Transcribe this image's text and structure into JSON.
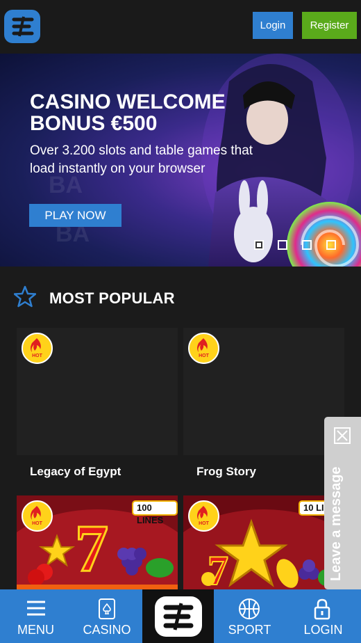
{
  "header": {
    "logo_icon": "brand-logo-icon",
    "login_label": "Login",
    "register_label": "Register"
  },
  "hero": {
    "title": "CASINO WELCOME BONUS €500",
    "subtitle": "Over 3.200 slots and table games that load instantly on your browser",
    "cta_label": "PLAY NOW",
    "slide_count": 4,
    "active_slide": 1
  },
  "section": {
    "icon": "star-icon",
    "title": "MOST POPULAR"
  },
  "games": [
    {
      "name": "Legacy of Egypt",
      "badge": "HOT"
    },
    {
      "name": "Frog Story",
      "badge": "HOT"
    },
    {
      "name": "",
      "badge": "HOT",
      "lines": "100 LINES"
    },
    {
      "name": "",
      "badge": "HOT",
      "lines": "10 LI"
    }
  ],
  "chat": {
    "label": "Leave a message"
  },
  "bottom_nav": {
    "items": [
      {
        "label": "MENU",
        "icon": "hamburger-icon"
      },
      {
        "label": "CASINO",
        "icon": "card-icon"
      },
      {
        "label": "SPORT",
        "icon": "basketball-icon"
      },
      {
        "label": "LOGIN",
        "icon": "lock-icon"
      }
    ]
  },
  "colors": {
    "accent": "#2f7fd0",
    "register": "#5aaa1b",
    "background": "#1b1b1b",
    "hot_badge": "#ffd21a"
  }
}
